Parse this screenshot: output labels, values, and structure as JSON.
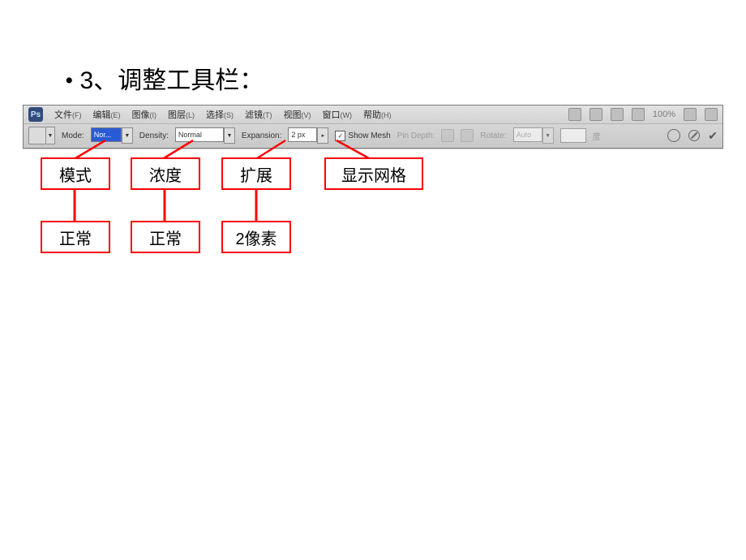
{
  "heading": {
    "bullet": "•",
    "text": "3、调整工具栏："
  },
  "ps": {
    "logo": "Ps",
    "menus": [
      {
        "label": "文件",
        "acc": "(F)"
      },
      {
        "label": "编辑",
        "acc": "(E)"
      },
      {
        "label": "图像",
        "acc": "(I)"
      },
      {
        "label": "图层",
        "acc": "(L)"
      },
      {
        "label": "选择",
        "acc": "(S)"
      },
      {
        "label": "滤镜",
        "acc": "(T)"
      },
      {
        "label": "视图",
        "acc": "(V)"
      },
      {
        "label": "窗口",
        "acc": "(W)"
      },
      {
        "label": "帮助",
        "acc": "(H)"
      }
    ],
    "zoom": "100%",
    "options": {
      "mode_label": "Mode:",
      "mode_value": "Nor...",
      "density_label": "Density:",
      "density_value": "Normal",
      "expansion_label": "Expansion:",
      "expansion_value": "2 px",
      "showmesh_label": "Show Mesh",
      "showmesh_checked": "✓",
      "pindepth_label": "Pin Depth:",
      "rotate_label": "Rotate:",
      "rotate_value": "Auto",
      "rotate_unit": "度"
    }
  },
  "annotations": {
    "row1": {
      "mode": "模式",
      "density": "浓度",
      "expansion": "扩展",
      "showmesh": "显示网格"
    },
    "row2": {
      "mode_val": "正常",
      "density_val": "正常",
      "expansion_val": "2像素"
    }
  }
}
